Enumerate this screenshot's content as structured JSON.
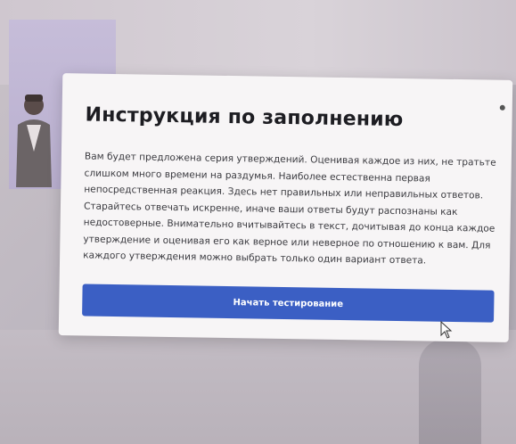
{
  "modal": {
    "title": "Инструкция по заполнению",
    "instructions": "Вам будет предложена серия утверждений. Оценивая каждое из них, не тратьте слишком много времени на раздумья. Наиболее естественна первая непосредственная реакция. Здесь нет правильных или неправильных ответов. Старайтесь отвечать искренне, иначе ваши ответы будут распознаны как недостоверные. Внимательно вчитывайтесь в текст, дочитывая до конца каждое утверждение и оценивая его как верное или неверное по отношению к вам. Для каждого утверждения можно выбрать только один вариант ответа.",
    "start_button": "Начать тестирование"
  },
  "colors": {
    "button": "#3b5fc4",
    "modal_background": "#f7f5f6",
    "title": "#1d1d22"
  },
  "icons": {
    "cursor": "mouse-cursor-icon",
    "dot": "dot-indicator-icon"
  }
}
